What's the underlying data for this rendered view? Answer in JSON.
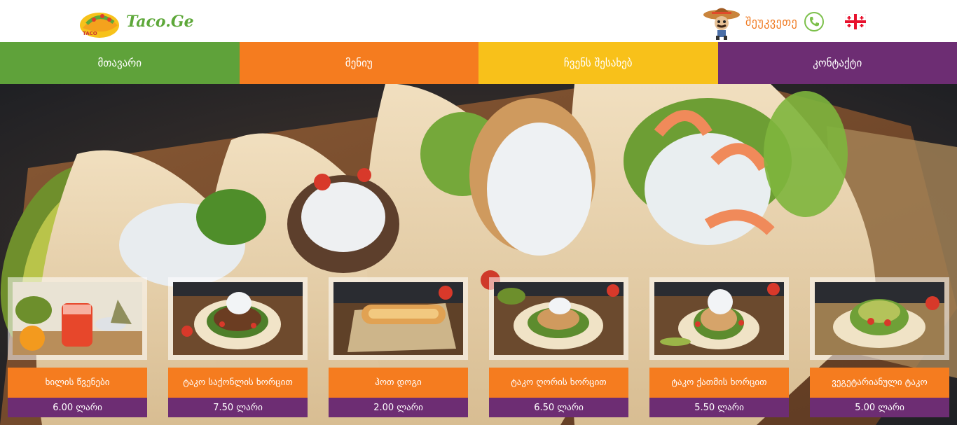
{
  "brand": {
    "name": "Taco.Ge"
  },
  "header": {
    "call_label": "შეუკვეთე"
  },
  "nav": [
    {
      "label": "მთავარი",
      "color": "#5fa23a"
    },
    {
      "label": "მენიუ",
      "color": "#f57c1f"
    },
    {
      "label": "ჩვენს შესახებ",
      "color": "#f8c11a"
    },
    {
      "label": "კონტაქტი",
      "color": "#6d2d73"
    }
  ],
  "products": [
    {
      "title": "ხილის წვენები",
      "price": "6.00 ლარი",
      "image": "fruit-juice"
    },
    {
      "title": "ტაკო საქონლის ხორცით",
      "price": "7.50 ლარი",
      "image": "beef-taco"
    },
    {
      "title": "ჰოთ დოგი",
      "price": "2.00 ლარი",
      "image": "hot-dog"
    },
    {
      "title": "ტაკო ღორის ხორცით",
      "price": "6.50 ლარი",
      "image": "pork-taco"
    },
    {
      "title": "ტაკო ქათმის ხორცით",
      "price": "5.50 ლარი",
      "image": "chicken-taco"
    },
    {
      "title": "ვეგეტარიანული ტაკო",
      "price": "5.00 ლარი",
      "image": "veggie-taco"
    }
  ],
  "icons": {
    "phone": "phone-icon",
    "flag": "georgian-flag-icon",
    "mascot": "sombrero-mascot-icon",
    "logo": "taco-logo-icon"
  }
}
